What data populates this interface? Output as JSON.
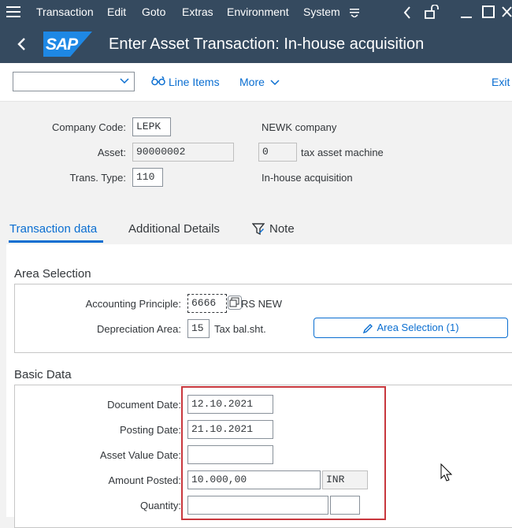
{
  "menubar": {
    "items": [
      "Transaction",
      "Edit",
      "Goto",
      "Extras",
      "Environment",
      "System"
    ]
  },
  "titlebar": {
    "logo_text": "SAP",
    "title": "Enter Asset Transaction: In-house acquisition"
  },
  "toolbar": {
    "line_items_label": "Line Items",
    "more_label": "More",
    "exit_label": "Exit"
  },
  "header": {
    "company_code_label": "Company Code:",
    "company_code_value": "LEPK",
    "company_name": "NEWK company",
    "asset_label": "Asset:",
    "asset_value": "90000002",
    "asset_sub_value": "0",
    "asset_description": "tax asset machine",
    "trans_type_label": "Trans. Type:",
    "trans_type_value": "110",
    "trans_type_description": "In-house acquisition"
  },
  "tabs": [
    "Transaction data",
    "Additional Details",
    "Note"
  ],
  "area_selection": {
    "section_title": "Area Selection",
    "accounting_principle_label": "Accounting Principle:",
    "accounting_principle_value": "6666",
    "accounting_principle_text": "RS NEW",
    "depreciation_area_label": "Depreciation Area:",
    "depreciation_area_value": "15",
    "depreciation_area_text": "Tax bal.sht.",
    "area_selection_button": "Area Selection (1)"
  },
  "basic_data": {
    "section_title": "Basic Data",
    "document_date_label": "Document Date:",
    "document_date_value": "12.10.2021",
    "posting_date_label": "Posting Date:",
    "posting_date_value": "21.10.2021",
    "asset_value_date_label": "Asset Value Date:",
    "asset_value_date_value": "",
    "amount_posted_label": "Amount Posted:",
    "amount_posted_value": "10.000,00",
    "currency_value": "INR",
    "quantity_label": "Quantity:",
    "quantity_value": ""
  },
  "colors": {
    "shell": "#354a5f",
    "accent": "#0a6ed1",
    "highlight": "#c8373d"
  }
}
